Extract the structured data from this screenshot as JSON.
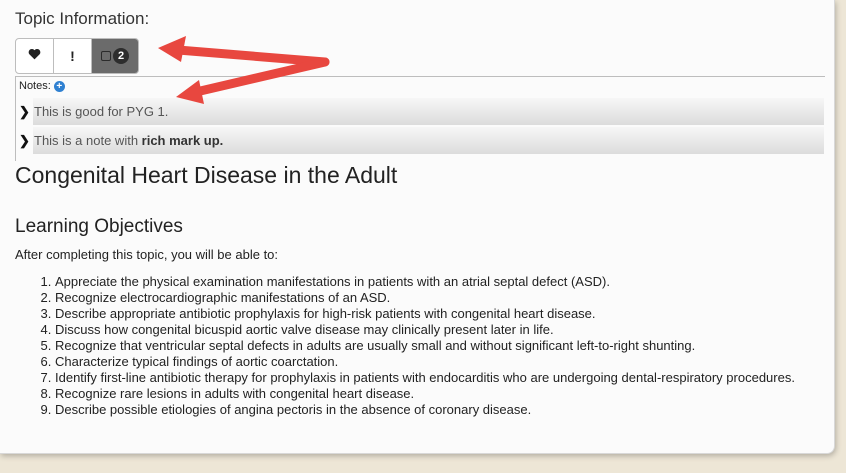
{
  "topic_info": {
    "heading": "Topic Information:"
  },
  "toolbar": {
    "favorite_icon": "heart-icon",
    "flag_icon": "exclamation-icon",
    "flag_label": "!",
    "notes_icon": "notes-icon",
    "notes_count": "2"
  },
  "notes": {
    "label": "Notes:",
    "add_icon": "plus-icon",
    "items": [
      {
        "text": "This is good for PYG 1."
      },
      {
        "text_plain": "This is a note with ",
        "text_bold": "rich mark up."
      }
    ]
  },
  "topic": {
    "title": "Congenital Heart Disease in the Adult",
    "section_title": "Learning Objectives",
    "intro": "After completing this topic, you will be able to:",
    "objectives": [
      "Appreciate the physical examination manifestations in patients with an atrial septal defect (ASD).",
      "Recognize electrocardiographic manifestations of an ASD.",
      "Describe appropriate antibiotic prophylaxis for high-risk patients with congenital heart disease.",
      "Discuss how congenital bicuspid aortic valve disease may clinically present later in life.",
      "Recognize that ventricular septal defects in adults are usually small and without significant left-to-right shunting.",
      "Characterize typical findings of aortic coarctation.",
      "Identify first-line antibiotic therapy for prophylaxis in patients with endocarditis who are undergoing dental-respiratory procedures.",
      "Recognize rare lesions in adults with congenital heart disease.",
      "Describe possible etiologies of angina pectoris in the absence of coronary disease."
    ]
  },
  "colors": {
    "arrow": "#e8473f",
    "add_icon": "#2f80d1",
    "active_button": "#6b6b6b"
  }
}
